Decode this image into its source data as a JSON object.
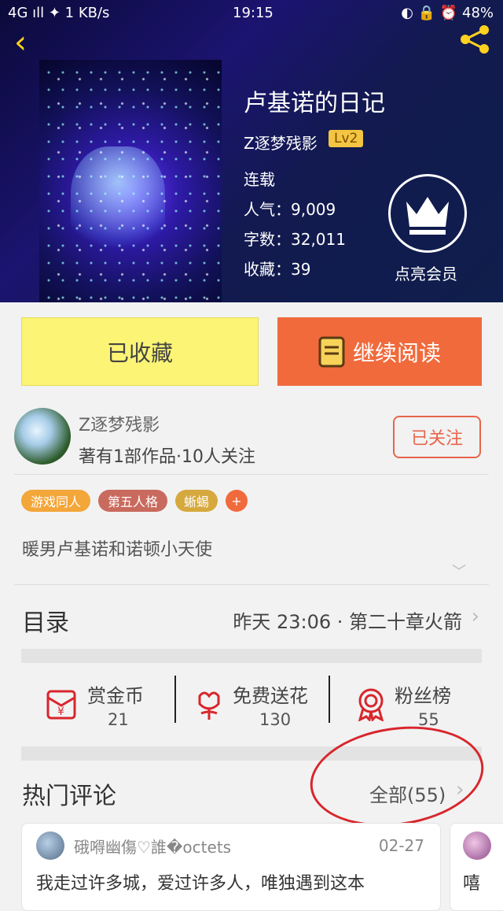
{
  "status_bar": {
    "left": "4G ıll ✦ 1 KB/s",
    "time": "19:15",
    "right": "◐ 🔒 ⏰ 48%"
  },
  "book": {
    "title": "卢基诺的日记",
    "author": "Z逐梦残影",
    "level": "Lv2",
    "status": "连载",
    "popularity": "人气：9,009",
    "word_count": "字数：32,011",
    "favorites": "收藏：39"
  },
  "member": {
    "label": "点亮会员"
  },
  "buttons": {
    "favorited": "已收藏",
    "continue": "继续阅读"
  },
  "author_info": {
    "name": "Z逐梦残影",
    "subtitle": "著有1部作品·10人关注",
    "follow": "已关注"
  },
  "tags": [
    {
      "label": "游戏同人",
      "color": "#f3a639"
    },
    {
      "label": "第五人格",
      "color": "#c96a5e"
    },
    {
      "label": "蜥蜴",
      "color": "#d6a93e"
    },
    {
      "label": "+",
      "color": "#f06a3c"
    }
  ],
  "description": "暖男卢基诺和诺顿小天使",
  "toc": {
    "title": "目录",
    "latest": "昨天 23:06 · 第二十章火箭"
  },
  "stats": [
    {
      "label": "赏金币",
      "value": "21"
    },
    {
      "label": "免费送花",
      "value": "130"
    },
    {
      "label": "粉丝榜",
      "value": "55"
    }
  ],
  "hot_comments": {
    "title": "热门评论",
    "all": "全部(55)"
  },
  "comments": [
    {
      "name": "硪嘚幽傷♡誰�octets",
      "date": "02-27",
      "text": "我走过许多城，爱过许多人，唯独遇到这本"
    },
    {
      "text": "嘻"
    }
  ]
}
